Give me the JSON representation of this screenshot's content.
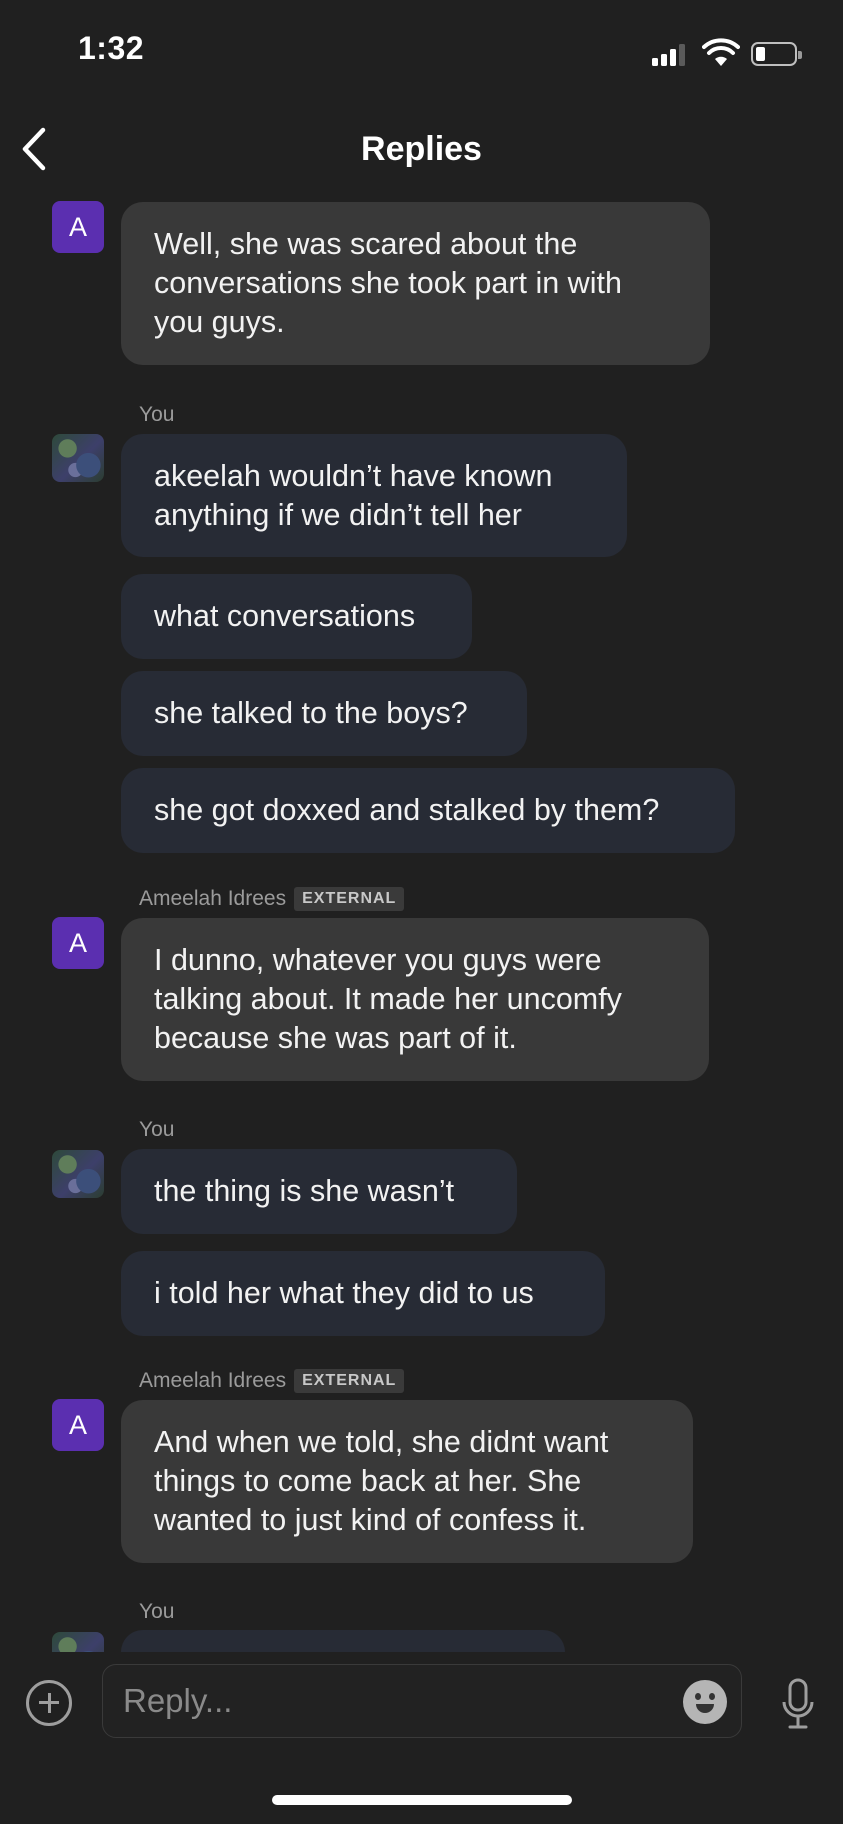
{
  "status_bar": {
    "time": "1:32"
  },
  "header": {
    "title": "Replies",
    "back_icon": "chevron-left-icon"
  },
  "avatar_letter": "A",
  "labels": {
    "you": "You",
    "external": "EXTERNAL",
    "ameelah": "Ameelah Idrees"
  },
  "messages": [
    {
      "text": "Well, she was scared about the conversations she took part in with you guys."
    },
    {
      "text": "akeelah wouldn’t have known anything if we didn’t tell her"
    },
    {
      "text": "what conversations"
    },
    {
      "text": "she talked to the boys?"
    },
    {
      "text": "she got doxxed and stalked by them?"
    },
    {
      "text": "I dunno, whatever you guys were talking about. It made her uncomfy because she was part of it."
    },
    {
      "text": "the thing is she wasn’t"
    },
    {
      "text": "i told her what they did to us"
    },
    {
      "text": "And when we told, she didnt want things to come back at her. She wanted to just kind of confess it."
    }
  ],
  "composer": {
    "placeholder": "Reply...",
    "icons": [
      "plus-circle-icon",
      "emoji-icon",
      "microphone-icon"
    ]
  },
  "colors": {
    "background": "#202020",
    "their_bubble": "#393939",
    "my_bubble": "#272b35",
    "avatar": "#5b2fb0"
  }
}
